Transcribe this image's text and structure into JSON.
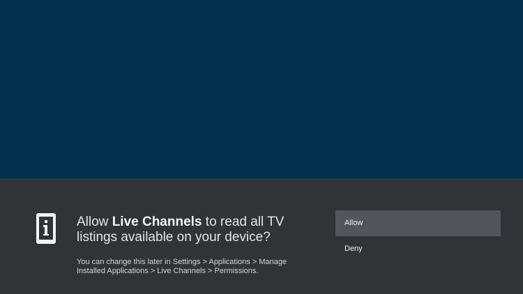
{
  "dialog": {
    "message_prefix": "Allow ",
    "app_name": "Live Channels",
    "message_suffix": " to read all TV listings available on your device?",
    "detail": "You can change this later in Settings > Applications > Manage Installed Applications > Live Channels > Permissions.",
    "icon": "permission-info-icon"
  },
  "options": {
    "allow_label": "Allow",
    "deny_label": "Deny"
  },
  "colors": {
    "background": "#03324f",
    "panel": "#2f3439",
    "selected_option": "#50565c",
    "text": "#e3e6e8"
  }
}
